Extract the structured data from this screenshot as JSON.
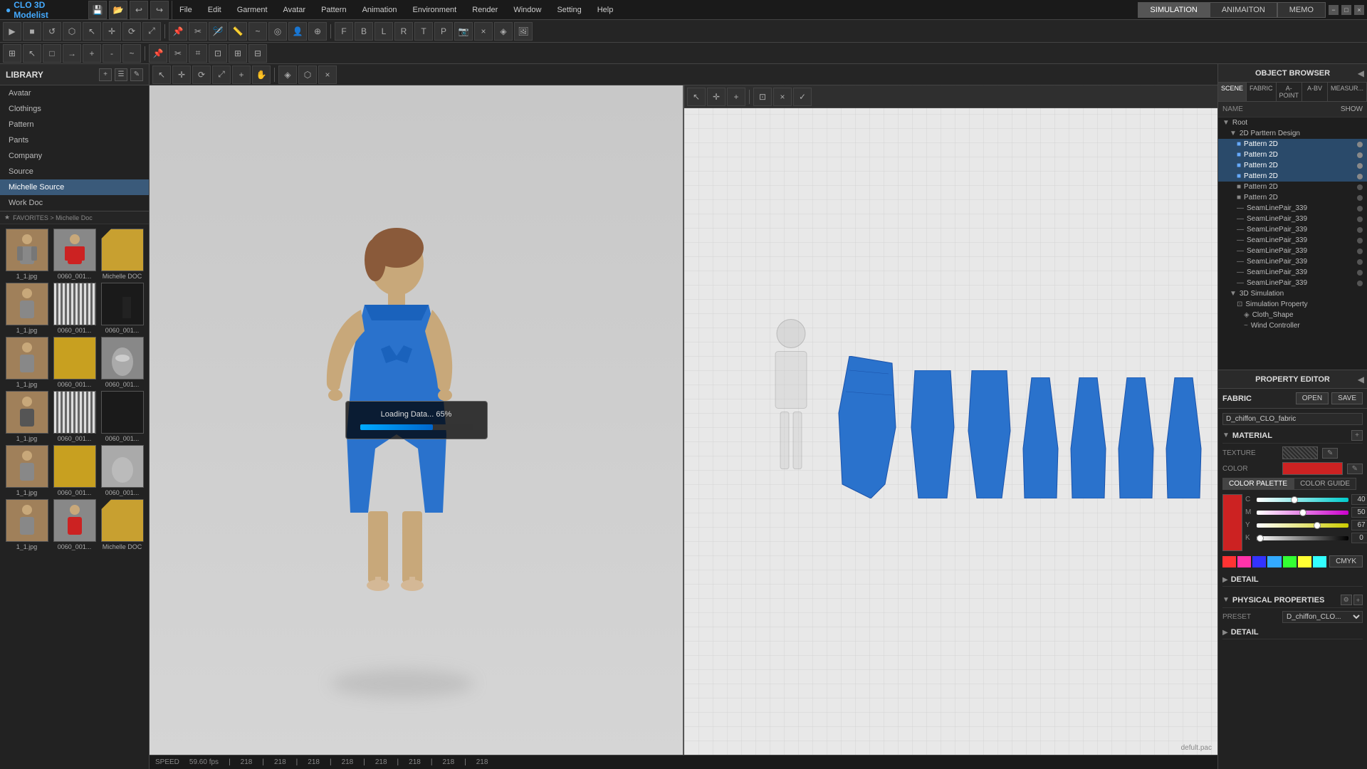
{
  "app": {
    "title": "CLO 3D Modelist",
    "logo": "CLO"
  },
  "menu": {
    "items": [
      "File",
      "Edit",
      "Garment",
      "Avatar",
      "Pattern",
      "Animation",
      "Environment",
      "Render",
      "Window",
      "Setting",
      "Help"
    ]
  },
  "top_tabs": {
    "items": [
      "SIMULATION",
      "ANIMAITON",
      "MEMO"
    ],
    "active": "SIMULATION"
  },
  "library": {
    "title": "LIBRARY",
    "header_icons": [
      "+",
      "☰",
      "✎"
    ],
    "nav_items": [
      "Avatar",
      "Clothings",
      "Pattern",
      "Pants",
      "Company",
      "Source",
      "Michelle Source",
      "Work Doc"
    ],
    "active_nav": "Michelle Source",
    "breadcrumb": [
      "FAVORITES",
      "Michelle Doc"
    ],
    "items": [
      {
        "label": "1_1.jpg",
        "type": "avatar_f"
      },
      {
        "label": "0060_001...",
        "type": "avatar_m"
      },
      {
        "label": "Michelle DOC",
        "type": "folder"
      },
      {
        "label": "1_1.jpg",
        "type": "avatar_f2"
      },
      {
        "label": "0060_001...",
        "type": "striped"
      },
      {
        "label": "0060_001...",
        "type": "jacket"
      },
      {
        "label": "1_1.jpg",
        "type": "avatar_f3"
      },
      {
        "label": "0060_001...",
        "type": "yellow"
      },
      {
        "label": "0060_001...",
        "type": "silver"
      },
      {
        "label": "1_1.jpg",
        "type": "avatar_f4"
      },
      {
        "label": "0060_001...",
        "type": "striped2"
      },
      {
        "label": "0060_001...",
        "type": "jacket2"
      },
      {
        "label": "1_1.jpg",
        "type": "avatar_f5"
      },
      {
        "label": "0060_001...",
        "type": "yellow2"
      },
      {
        "label": "0060_001...",
        "type": "silver2"
      },
      {
        "label": "1_1.jpg",
        "type": "avatar_f6"
      },
      {
        "label": "0060_001...",
        "type": "avatar_m2"
      },
      {
        "label": "Michelle DOC",
        "type": "folder2"
      }
    ]
  },
  "loading": {
    "text": "Loading Data... 65%",
    "progress": 65
  },
  "status_bar": {
    "speed_label": "SPEED",
    "speed_value": "59.60 fps",
    "coords": [
      "218",
      "218",
      "218",
      "218",
      "218",
      "218",
      "218",
      "218"
    ],
    "filename": "defult.pac"
  },
  "object_browser": {
    "title": "OBJECT BROWSER",
    "tabs": [
      "SCENE",
      "FABRIC",
      "A-POINT",
      "A-BV",
      "MEASUR..."
    ],
    "active_tab": "SCENE",
    "name_label": "NAME",
    "show_label": "SHOW",
    "tree": [
      {
        "label": "Root",
        "indent": 0,
        "type": "group"
      },
      {
        "label": "2D Parttern Design",
        "indent": 1,
        "type": "group"
      },
      {
        "label": "Pattern 2D",
        "indent": 2,
        "type": "item",
        "selected": true,
        "dot": true
      },
      {
        "label": "Pattern 2D",
        "indent": 2,
        "type": "item",
        "selected": true,
        "dot": true
      },
      {
        "label": "Pattern 2D",
        "indent": 2,
        "type": "item",
        "selected": true,
        "dot": true
      },
      {
        "label": "Pattern 2D",
        "indent": 2,
        "type": "item",
        "selected": true,
        "dot": true
      },
      {
        "label": "Pattern 2D",
        "indent": 2,
        "type": "item",
        "dot": true
      },
      {
        "label": "Pattern 2D",
        "indent": 2,
        "type": "item",
        "dot": true
      },
      {
        "label": "SeamLinePair_339",
        "indent": 2,
        "type": "item",
        "dot": true
      },
      {
        "label": "SeamLinePair_339",
        "indent": 2,
        "type": "item",
        "dot": true
      },
      {
        "label": "SeamLinePair_339",
        "indent": 2,
        "type": "item",
        "dot": true
      },
      {
        "label": "SeamLinePair_339",
        "indent": 2,
        "type": "item",
        "dot": true
      },
      {
        "label": "SeamLinePair_339",
        "indent": 2,
        "type": "item",
        "dot": true
      },
      {
        "label": "SeamLinePair_339",
        "indent": 2,
        "type": "item",
        "dot": true
      },
      {
        "label": "SeamLinePair_339",
        "indent": 2,
        "type": "item",
        "dot": true
      },
      {
        "label": "SeamLinePair_339",
        "indent": 2,
        "type": "item",
        "dot": true
      },
      {
        "label": "3D Simulation",
        "indent": 1,
        "type": "group"
      },
      {
        "label": "Simulation Property",
        "indent": 2,
        "type": "item"
      },
      {
        "label": "Cloth_Shape",
        "indent": 3,
        "type": "item"
      },
      {
        "label": "Wind Controller",
        "indent": 3,
        "type": "item"
      }
    ]
  },
  "property_editor": {
    "title": "PROPERTY EDITOR",
    "section_label": "FABRIC",
    "open_label": "OPEN",
    "save_label": "SAVE",
    "fabric_name": "D_chiffon_CLO_fabric",
    "material_section": "MATERIAL",
    "texture_label": "TEXTURE",
    "color_label": "COLOR",
    "color_value": "#cc2222",
    "color_palette_label": "COLOR PALETTE",
    "color_guide_label": "COLOR GUIDE",
    "cmyk": {
      "C": {
        "value": 40,
        "label": "C"
      },
      "M": {
        "value": 50,
        "label": "M"
      },
      "Y": {
        "value": 67,
        "label": "Y"
      },
      "K": {
        "value": 0,
        "label": "K"
      }
    },
    "cmyk_mode": "CMYK",
    "swatches": [
      "#ff3333",
      "#33aaff",
      "#33ff33",
      "#ffff33",
      "#ff33ff",
      "#33ffff",
      "#ff8833"
    ],
    "detail_label": "DETAIL",
    "physical_properties_label": "PHYSICAL PROPERTIES",
    "preset_label": "PRESET",
    "preset_value": "D_chiffon_CLO...",
    "physical_detail_label": "DETAIL"
  }
}
